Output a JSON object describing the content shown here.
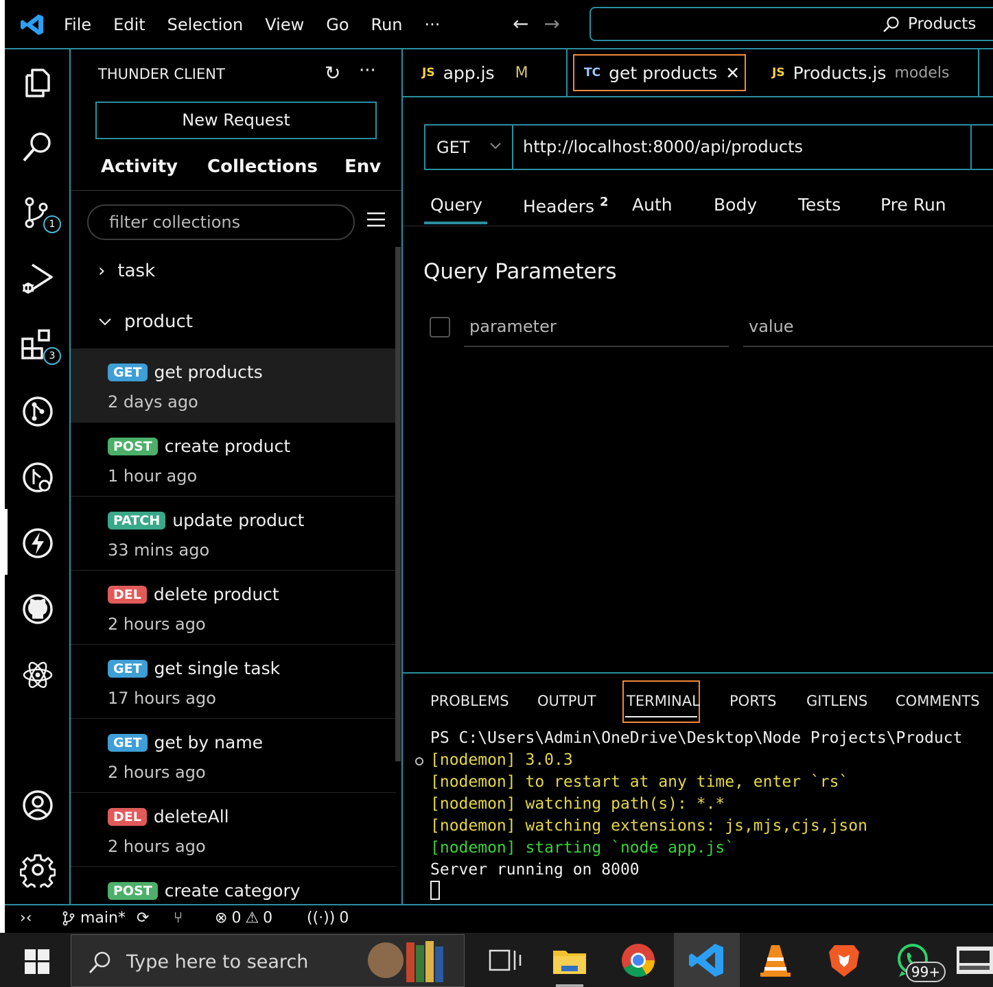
{
  "titlebar": {
    "menu": [
      "File",
      "Edit",
      "Selection",
      "View",
      "Go",
      "Run",
      "···"
    ],
    "search_text": "Products"
  },
  "activity": {
    "scm_badge": "1",
    "extensions_badge": "3"
  },
  "sidebar": {
    "title": "THUNDER CLIENT",
    "new_request": "New Request",
    "tabs": [
      "Activity",
      "Collections",
      "Env"
    ],
    "filter_placeholder": "filter collections",
    "folders": [
      {
        "name": "task",
        "expanded": false
      },
      {
        "name": "product",
        "expanded": true
      }
    ],
    "requests": [
      {
        "method": "GET",
        "name": "get products",
        "time": "2 days ago",
        "color": "#3e9ed6"
      },
      {
        "method": "POST",
        "name": "create product",
        "time": "1 hour ago",
        "color": "#4caf6a"
      },
      {
        "method": "PATCH",
        "name": "update product",
        "time": "33 mins ago",
        "color": "#3aa88a"
      },
      {
        "method": "DEL",
        "name": "delete product",
        "time": "2 hours ago",
        "color": "#e05a5a"
      },
      {
        "method": "GET",
        "name": "get single task",
        "time": "17 hours ago",
        "color": "#3e9ed6"
      },
      {
        "method": "GET",
        "name": "get by name",
        "time": "2 hours ago",
        "color": "#3e9ed6"
      },
      {
        "method": "DEL",
        "name": "deleteAll",
        "time": "2 hours ago",
        "color": "#e05a5a"
      },
      {
        "method": "POST",
        "name": "create category",
        "time": "",
        "color": "#4caf6a"
      }
    ]
  },
  "editor": {
    "tabs": [
      {
        "icon": "JS",
        "label": "app.js",
        "extra": "M"
      },
      {
        "icon": "TC",
        "label": "get products",
        "extra": "✕"
      },
      {
        "icon": "JS",
        "label": "Products.js",
        "extra": "models"
      }
    ],
    "method": "GET",
    "url": "http://localhost:8000/api/products",
    "request_tabs": [
      "Query",
      "Headers",
      "Auth",
      "Body",
      "Tests",
      "Pre Run"
    ],
    "headers_count": "2",
    "query_title": "Query Parameters",
    "param_placeholder": "parameter",
    "value_placeholder": "value"
  },
  "panel": {
    "tabs": [
      "PROBLEMS",
      "OUTPUT",
      "TERMINAL",
      "PORTS",
      "GITLENS",
      "COMMENTS"
    ],
    "terminal": {
      "prompt": "PS C:\\Users\\Admin\\OneDrive\\Desktop\\Node Projects\\Product",
      "lines": [
        {
          "text": "[nodemon] 3.0.3",
          "color": "yellow"
        },
        {
          "text": "[nodemon] to restart at any time, enter `rs`",
          "color": "yellow"
        },
        {
          "text": "[nodemon] watching path(s): *.*",
          "color": "yellow"
        },
        {
          "text": "[nodemon] watching extensions: js,mjs,cjs,json",
          "color": "yellow"
        },
        {
          "text": "[nodemon] starting `node app.js`",
          "color": "green"
        },
        {
          "text": "Server running on 8000",
          "color": "white"
        }
      ]
    }
  },
  "statusbar": {
    "branch": "main*",
    "errors": "0",
    "warnings": "0",
    "ports": "0"
  },
  "taskbar": {
    "search_placeholder": "Type here to search",
    "whatsapp_badge": "99+"
  }
}
